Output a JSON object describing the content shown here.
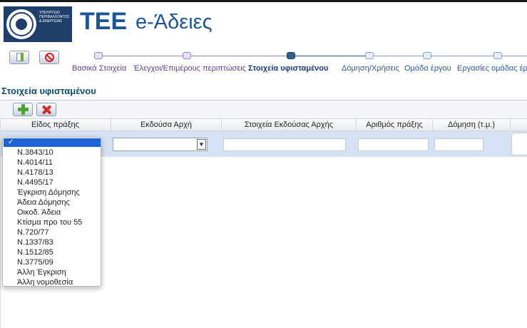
{
  "header": {
    "ministry_lines": [
      "ΥΠΟΥΡΓΕΙΟ",
      "ΠΕΡΙΒΑΛΛΟΝΤΟΣ",
      "& ΕΝΕΡΓΕΙΑΣ"
    ],
    "brand_tee": "ΤΕΕ",
    "brand_app": "e-Άδειες"
  },
  "toolbar": {
    "list_icon": "checklist-icon",
    "cancel_icon": "cancel-icon"
  },
  "wizard": {
    "steps": [
      {
        "label": "Βασικά Στοιχεία",
        "state": "done"
      },
      {
        "label": "Έλεγχοι/Επιμέρους περιπτώσεις",
        "state": "done"
      },
      {
        "label": "Στοιχεία υφισταμένου",
        "state": "current"
      },
      {
        "label": "Δόμηση/Χρήσεις",
        "state": "todo"
      },
      {
        "label": "Ομάδα έργου",
        "state": "todo"
      },
      {
        "label": "Εργασίες ομάδας έργ",
        "state": "todo"
      }
    ]
  },
  "section": {
    "title": "Στοιχεία υφισταμένου"
  },
  "grid": {
    "add_icon": "plus-icon",
    "delete_icon": "delete-x-icon",
    "columns": [
      "Είδος πράξης",
      "Εκδούσα Αρχή",
      "Στοιχεία Εκδούσας Αρχής",
      "Αριθμός πράξης",
      "Δόμηση (τ.μ.)"
    ],
    "row": {
      "issuing_authority": "",
      "authority_details": "",
      "act_number": "",
      "area": ""
    }
  },
  "dropdown": {
    "selected": "",
    "options": [
      "Ν.3843/10",
      "Ν.4014/11",
      "Ν.4178/13",
      "Ν.4495/17",
      "Έγκριση Δόμησης",
      "Άδεια Δόμησης",
      "Οικοδ. Άδεια",
      "Κτίσμα προ του 55",
      "Ν.720/77",
      "Ν.1337/83",
      "Ν.1512/85",
      "Ν.3775/09",
      "Άλλη Έγκριση",
      "Άλλη νομοθεσία"
    ]
  },
  "colors": {
    "brand": "#1e5597",
    "section_title": "#134a6a",
    "row_highlight": "#d5e2f3",
    "dropdown_selected": "#1f64d6"
  }
}
